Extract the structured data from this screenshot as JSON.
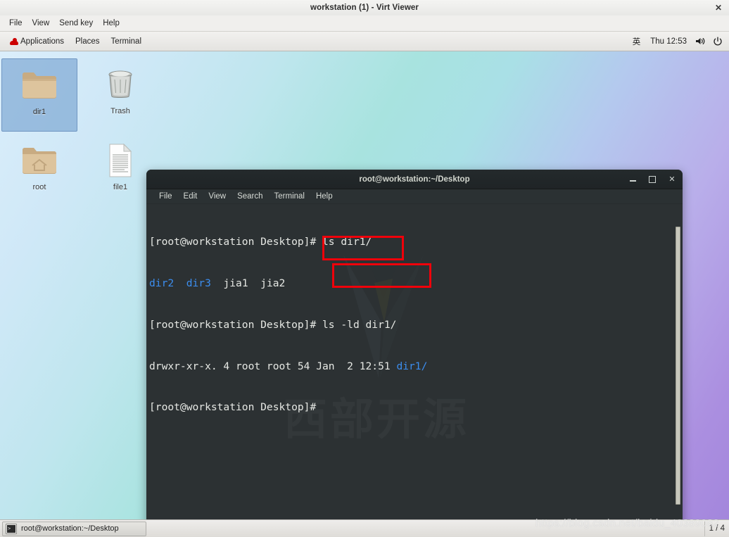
{
  "viewer": {
    "title": "workstation (1) - Virt Viewer",
    "close_label": "✕",
    "menus": [
      "File",
      "View",
      "Send key",
      "Help"
    ]
  },
  "gnome_panel": {
    "logo_icon": "redhat-icon",
    "items": [
      "Applications",
      "Places",
      "Terminal"
    ],
    "input_method": "英",
    "clock": "Thu 12:53",
    "volume_icon": "volume-icon",
    "power_icon": "power-icon"
  },
  "desktop": {
    "icons": [
      {
        "name": "dir1",
        "type": "folder",
        "selected": true
      },
      {
        "name": "Trash",
        "type": "trash",
        "selected": false
      },
      {
        "name": "root",
        "type": "home-folder",
        "selected": false
      },
      {
        "name": "file1",
        "type": "text-file",
        "selected": false
      }
    ]
  },
  "terminal": {
    "title": "root@workstation:~/Desktop",
    "menus": [
      "File",
      "Edit",
      "View",
      "Search",
      "Terminal",
      "Help"
    ],
    "window_buttons": {
      "minimize": "minimize",
      "maximize": "maximize",
      "close": "✕"
    },
    "watermark_text": "西部开源",
    "lines": [
      {
        "segments": [
          {
            "text": "[root@workstation Desktop]# ",
            "color": "white"
          },
          {
            "text": "ls dir1/",
            "color": "white"
          }
        ]
      },
      {
        "segments": [
          {
            "text": "dir2",
            "color": "blue"
          },
          {
            "text": "  ",
            "color": "white"
          },
          {
            "text": "dir3",
            "color": "blue"
          },
          {
            "text": "  jia1  jia2",
            "color": "white"
          }
        ]
      },
      {
        "segments": [
          {
            "text": "[root@workstation Desktop]# ",
            "color": "white"
          },
          {
            "text": "ls -ld dir1/",
            "color": "white"
          }
        ]
      },
      {
        "segments": [
          {
            "text": "drwxr-xr-x. 4 root root 54 Jan  2 12:51 ",
            "color": "white"
          },
          {
            "text": "dir1/",
            "color": "blue"
          }
        ]
      },
      {
        "segments": [
          {
            "text": "[root@workstation Desktop]#",
            "color": "white"
          }
        ]
      }
    ],
    "annotations": [
      {
        "label": "ls dir1/",
        "color": "#f0000a"
      },
      {
        "label": "ls -ld dir1/",
        "color": "#f0000a"
      }
    ]
  },
  "taskbar": {
    "window_label": "root@workstation:~/Desktop",
    "workspace": "1 / 4"
  },
  "overlay": {
    "blog_watermark": "https://blog.csdn.net/baidu_40389082"
  },
  "colors": {
    "accent_red": "#f0000a",
    "terminal_bg": "#2c3133",
    "terminal_blue": "#3c8ef0",
    "selection_blue": "#729fcf"
  }
}
